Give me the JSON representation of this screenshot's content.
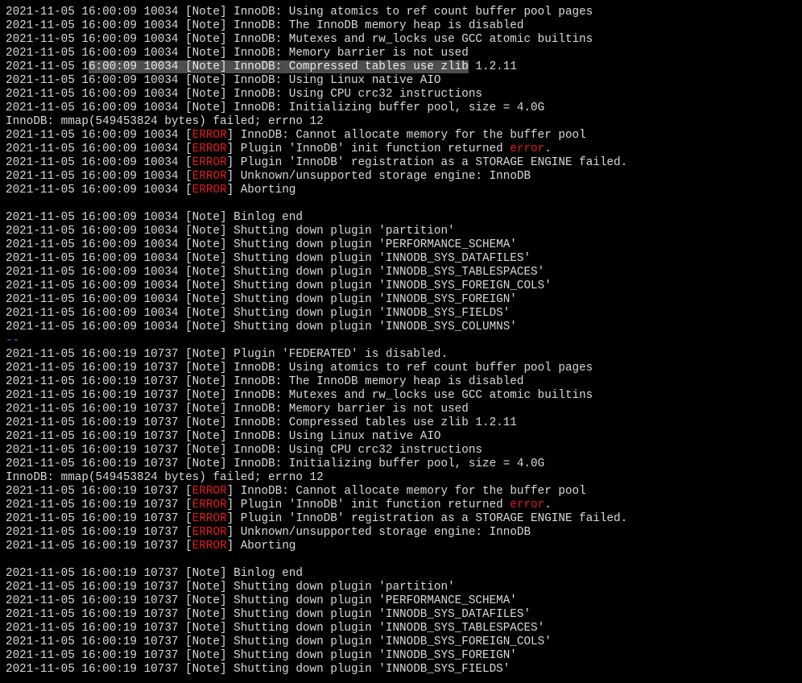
{
  "terminal": {
    "lines": [
      {
        "segments": [
          {
            "text": "2021-11-05 16:00:09 10034 [Note] InnoDB: Using atomics to ref count buffer pool pages",
            "style": ""
          }
        ]
      },
      {
        "segments": [
          {
            "text": "2021-11-05 16:00:09 10034 [Note] InnoDB: The InnoDB memory heap is disabled",
            "style": ""
          }
        ]
      },
      {
        "segments": [
          {
            "text": "2021-11-05 16:00:09 10034 [Note] InnoDB: Mutexes and rw_locks use GCC atomic builtins",
            "style": ""
          }
        ]
      },
      {
        "segments": [
          {
            "text": "2021-11-05 16:00:09 10034 [Note] InnoDB: Memory barrier is not used",
            "style": ""
          }
        ]
      },
      {
        "segments": [
          {
            "text": "2021-11-05 1",
            "style": ""
          },
          {
            "text": "6:00:09 10034 [Note] InnoDB: Compressed tables use zlib",
            "style": "hl"
          },
          {
            "text": " 1.2.11",
            "style": ""
          }
        ]
      },
      {
        "segments": [
          {
            "text": "2021-11-05 16:00:09 10034 [Note] InnoDB: Using Linux native AIO",
            "style": ""
          }
        ]
      },
      {
        "segments": [
          {
            "text": "2021-11-05 16:00:09 10034 [Note] InnoDB: Using CPU crc32 instructions",
            "style": ""
          }
        ]
      },
      {
        "segments": [
          {
            "text": "2021-11-05 16:00:09 10034 [Note] InnoDB: Initializing buffer pool, size = 4.0G",
            "style": ""
          }
        ]
      },
      {
        "segments": [
          {
            "text": "InnoDB: mmap(549453824 bytes) failed; errno 12",
            "style": ""
          }
        ]
      },
      {
        "segments": [
          {
            "text": "2021-11-05 16:00:09 10034 [",
            "style": ""
          },
          {
            "text": "ERROR",
            "style": "err"
          },
          {
            "text": "] InnoDB: Cannot allocate memory for the buffer pool",
            "style": ""
          }
        ]
      },
      {
        "segments": [
          {
            "text": "2021-11-05 16:00:09 10034 [",
            "style": ""
          },
          {
            "text": "ERROR",
            "style": "err"
          },
          {
            "text": "] Plugin 'InnoDB' init function returned ",
            "style": ""
          },
          {
            "text": "error",
            "style": "err"
          },
          {
            "text": ".",
            "style": ""
          }
        ]
      },
      {
        "segments": [
          {
            "text": "2021-11-05 16:00:09 10034 [",
            "style": ""
          },
          {
            "text": "ERROR",
            "style": "err"
          },
          {
            "text": "] Plugin 'InnoDB' registration as a STORAGE ENGINE failed.",
            "style": ""
          }
        ]
      },
      {
        "segments": [
          {
            "text": "2021-11-05 16:00:09 10034 [",
            "style": ""
          },
          {
            "text": "ERROR",
            "style": "err"
          },
          {
            "text": "] Unknown/unsupported storage engine: InnoDB",
            "style": ""
          }
        ]
      },
      {
        "segments": [
          {
            "text": "2021-11-05 16:00:09 10034 [",
            "style": ""
          },
          {
            "text": "ERROR",
            "style": "err"
          },
          {
            "text": "] Aborting",
            "style": ""
          }
        ]
      },
      {
        "segments": [
          {
            "text": "",
            "style": ""
          }
        ]
      },
      {
        "segments": [
          {
            "text": "2021-11-05 16:00:09 10034 [Note] Binlog end",
            "style": ""
          }
        ]
      },
      {
        "segments": [
          {
            "text": "2021-11-05 16:00:09 10034 [Note] Shutting down plugin 'partition'",
            "style": ""
          }
        ]
      },
      {
        "segments": [
          {
            "text": "2021-11-05 16:00:09 10034 [Note] Shutting down plugin 'PERFORMANCE_SCHEMA'",
            "style": ""
          }
        ]
      },
      {
        "segments": [
          {
            "text": "2021-11-05 16:00:09 10034 [Note] Shutting down plugin 'INNODB_SYS_DATAFILES'",
            "style": ""
          }
        ]
      },
      {
        "segments": [
          {
            "text": "2021-11-05 16:00:09 10034 [Note] Shutting down plugin 'INNODB_SYS_TABLESPACES'",
            "style": ""
          }
        ]
      },
      {
        "segments": [
          {
            "text": "2021-11-05 16:00:09 10034 [Note] Shutting down plugin 'INNODB_SYS_FOREIGN_COLS'",
            "style": ""
          }
        ]
      },
      {
        "segments": [
          {
            "text": "2021-11-05 16:00:09 10034 [Note] Shutting down plugin 'INNODB_SYS_FOREIGN'",
            "style": ""
          }
        ]
      },
      {
        "segments": [
          {
            "text": "2021-11-05 16:00:09 10034 [Note] Shutting down plugin 'INNODB_SYS_FIELDS'",
            "style": ""
          }
        ]
      },
      {
        "segments": [
          {
            "text": "2021-11-05 16:00:09 10034 [Note] Shutting down plugin 'INNODB_SYS_COLUMNS'",
            "style": ""
          }
        ]
      },
      {
        "segments": [
          {
            "text": "--",
            "style": "sep"
          }
        ]
      },
      {
        "segments": [
          {
            "text": "2021-11-05 16:00:19 10737 [Note] Plugin 'FEDERATED' is disabled.",
            "style": ""
          }
        ]
      },
      {
        "segments": [
          {
            "text": "2021-11-05 16:00:19 10737 [Note] InnoDB: Using atomics to ref count buffer pool pages",
            "style": ""
          }
        ]
      },
      {
        "segments": [
          {
            "text": "2021-11-05 16:00:19 10737 [Note] InnoDB: The InnoDB memory heap is disabled",
            "style": ""
          }
        ]
      },
      {
        "segments": [
          {
            "text": "2021-11-05 16:00:19 10737 [Note] InnoDB: Mutexes and rw_locks use GCC atomic builtins",
            "style": ""
          }
        ]
      },
      {
        "segments": [
          {
            "text": "2021-11-05 16:00:19 10737 [Note] InnoDB: Memory barrier is not used",
            "style": ""
          }
        ]
      },
      {
        "segments": [
          {
            "text": "2021-11-05 16:00:19 10737 [Note] InnoDB: Compressed tables use zlib 1.2.11",
            "style": ""
          }
        ]
      },
      {
        "segments": [
          {
            "text": "2021-11-05 16:00:19 10737 [Note] InnoDB: Using Linux native AIO",
            "style": ""
          }
        ]
      },
      {
        "segments": [
          {
            "text": "2021-11-05 16:00:19 10737 [Note] InnoDB: Using CPU crc32 instructions",
            "style": ""
          }
        ]
      },
      {
        "segments": [
          {
            "text": "2021-11-05 16:00:19 10737 [Note] InnoDB: Initializing buffer pool, size = 4.0G",
            "style": ""
          }
        ]
      },
      {
        "segments": [
          {
            "text": "InnoDB: mmap(549453824 bytes) failed; errno 12",
            "style": ""
          }
        ]
      },
      {
        "segments": [
          {
            "text": "2021-11-05 16:00:19 10737 [",
            "style": ""
          },
          {
            "text": "ERROR",
            "style": "err"
          },
          {
            "text": "] InnoDB: Cannot allocate memory for the buffer pool",
            "style": ""
          }
        ]
      },
      {
        "segments": [
          {
            "text": "2021-11-05 16:00:19 10737 [",
            "style": ""
          },
          {
            "text": "ERROR",
            "style": "err"
          },
          {
            "text": "] Plugin 'InnoDB' init function returned ",
            "style": ""
          },
          {
            "text": "error",
            "style": "err"
          },
          {
            "text": ".",
            "style": ""
          }
        ]
      },
      {
        "segments": [
          {
            "text": "2021-11-05 16:00:19 10737 [",
            "style": ""
          },
          {
            "text": "ERROR",
            "style": "err"
          },
          {
            "text": "] Plugin 'InnoDB' registration as a STORAGE ENGINE failed.",
            "style": ""
          }
        ]
      },
      {
        "segments": [
          {
            "text": "2021-11-05 16:00:19 10737 [",
            "style": ""
          },
          {
            "text": "ERROR",
            "style": "err"
          },
          {
            "text": "] Unknown/unsupported storage engine: InnoDB",
            "style": ""
          }
        ]
      },
      {
        "segments": [
          {
            "text": "2021-11-05 16:00:19 10737 [",
            "style": ""
          },
          {
            "text": "ERROR",
            "style": "err"
          },
          {
            "text": "] Aborting",
            "style": ""
          }
        ]
      },
      {
        "segments": [
          {
            "text": "",
            "style": ""
          }
        ]
      },
      {
        "segments": [
          {
            "text": "2021-11-05 16:00:19 10737 [Note] Binlog end",
            "style": ""
          }
        ]
      },
      {
        "segments": [
          {
            "text": "2021-11-05 16:00:19 10737 [Note] Shutting down plugin 'partition'",
            "style": ""
          }
        ]
      },
      {
        "segments": [
          {
            "text": "2021-11-05 16:00:19 10737 [Note] Shutting down plugin 'PERFORMANCE_SCHEMA'",
            "style": ""
          }
        ]
      },
      {
        "segments": [
          {
            "text": "2021-11-05 16:00:19 10737 [Note] Shutting down plugin 'INNODB_SYS_DATAFILES'",
            "style": ""
          }
        ]
      },
      {
        "segments": [
          {
            "text": "2021-11-05 16:00:19 10737 [Note] Shutting down plugin 'INNODB_SYS_TABLESPACES'",
            "style": ""
          }
        ]
      },
      {
        "segments": [
          {
            "text": "2021-11-05 16:00:19 10737 [Note] Shutting down plugin 'INNODB_SYS_FOREIGN_COLS'",
            "style": ""
          }
        ]
      },
      {
        "segments": [
          {
            "text": "2021-11-05 16:00:19 10737 [Note] Shutting down plugin 'INNODB_SYS_FOREIGN'",
            "style": ""
          }
        ]
      },
      {
        "segments": [
          {
            "text": "2021-11-05 16:00:19 10737 [Note] Shutting down plugin 'INNODB_SYS_FIELDS'",
            "style": ""
          }
        ]
      }
    ]
  },
  "colors": {
    "background": "#000000",
    "text": "#d9d9d9",
    "error": "#e31b1b",
    "separator": "#4a74d4",
    "selection": "#4d4d4d"
  }
}
